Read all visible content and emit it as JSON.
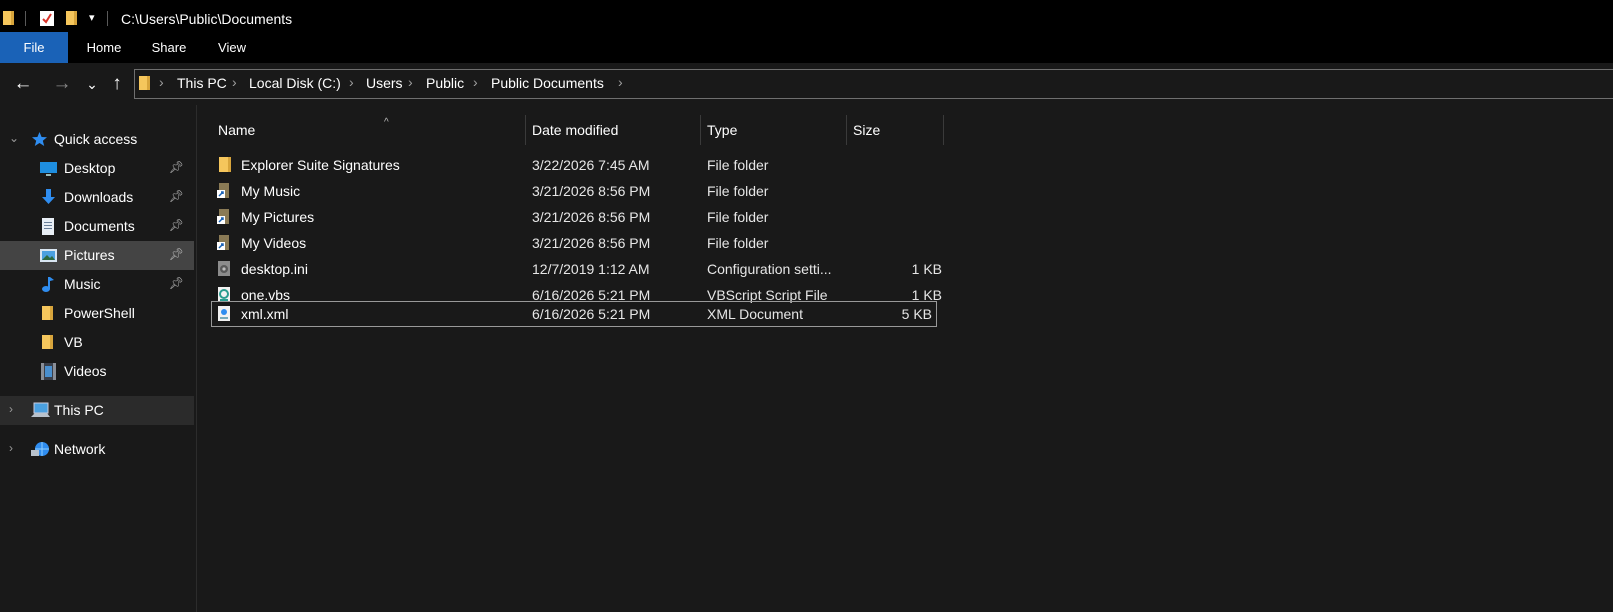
{
  "titlebar": {
    "path": "C:\\Users\\Public\\Documents",
    "qa_dropdown": "▾"
  },
  "ribbon": {
    "tabs": [
      "File",
      "Home",
      "Share",
      "View"
    ]
  },
  "nav": {
    "back": "←",
    "forward": "→",
    "recent": "⌄",
    "up": "↑"
  },
  "breadcrumb": [
    "This PC",
    "Local Disk (C:)",
    "Users",
    "Public",
    "Public Documents"
  ],
  "sidebar": {
    "quick_access": "Quick access",
    "items": [
      {
        "label": "Desktop",
        "icon": "desktop-icon",
        "pinned": true
      },
      {
        "label": "Downloads",
        "icon": "downloads-icon",
        "pinned": true
      },
      {
        "label": "Documents",
        "icon": "documents-icon",
        "pinned": true
      },
      {
        "label": "Pictures",
        "icon": "pictures-icon",
        "pinned": true,
        "selected": true
      },
      {
        "label": "Music",
        "icon": "music-icon",
        "pinned": true
      },
      {
        "label": "PowerShell",
        "icon": "folder-icon",
        "pinned": false
      },
      {
        "label": "VB",
        "icon": "folder-icon",
        "pinned": false
      },
      {
        "label": "Videos",
        "icon": "videos-icon",
        "pinned": false
      }
    ],
    "this_pc": "This PC",
    "network": "Network"
  },
  "columns": {
    "name": "Name",
    "date": "Date modified",
    "type": "Type",
    "size": "Size"
  },
  "files": [
    {
      "name": "Explorer Suite Signatures",
      "date": "3/22/2026 7:45 AM",
      "type": "File folder",
      "size": "",
      "icon": "folder-icon"
    },
    {
      "name": "My Music",
      "date": "3/21/2026 8:56 PM",
      "type": "File folder",
      "size": "",
      "icon": "shortcut-folder-icon"
    },
    {
      "name": "My Pictures",
      "date": "3/21/2026 8:56 PM",
      "type": "File folder",
      "size": "",
      "icon": "shortcut-folder-icon"
    },
    {
      "name": "My Videos",
      "date": "3/21/2026 8:56 PM",
      "type": "File folder",
      "size": "",
      "icon": "shortcut-folder-icon"
    },
    {
      "name": "desktop.ini",
      "date": "12/7/2019 1:12 AM",
      "type": "Configuration setti...",
      "size": "1 KB",
      "icon": "settings-file-icon"
    },
    {
      "name": "one.vbs",
      "date": "6/16/2026 5:21 PM",
      "type": "VBScript Script File",
      "size": "1 KB",
      "icon": "vbscript-file-icon"
    },
    {
      "name": "xml.xml",
      "date": "6/16/2026 5:21 PM",
      "type": "XML Document",
      "size": "5 KB",
      "icon": "xml-file-icon",
      "focused": true
    }
  ],
  "colors": {
    "background": "#191919",
    "file_tab": "#1a62b7",
    "selection": "#444444",
    "folder": "#f5c65c"
  }
}
